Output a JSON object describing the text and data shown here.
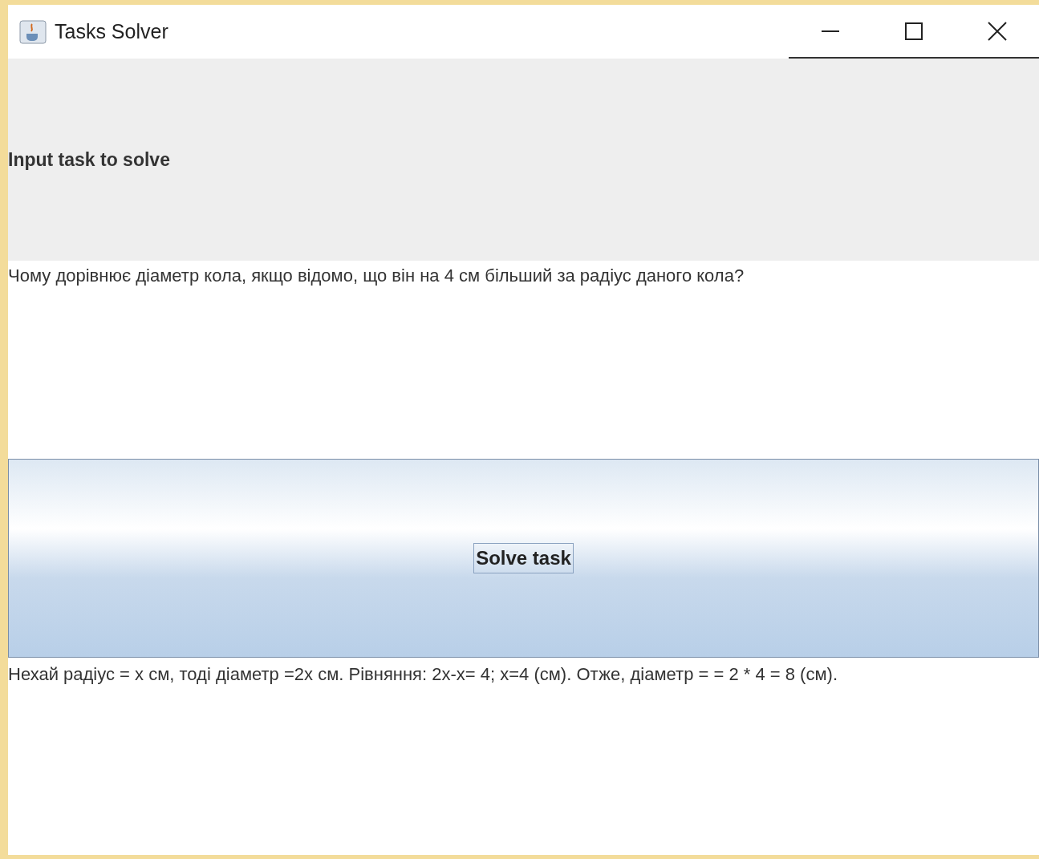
{
  "window": {
    "title": "Tasks Solver",
    "controls": [
      {
        "kind": "minimize"
      },
      {
        "kind": "maximize"
      },
      {
        "kind": "close"
      }
    ]
  },
  "prompt_label": "Input task to solve",
  "task_input": {
    "value": "Чому дорівнює діаметр кола, якщо відомо, що він на 4 см більший за радіус даного кола?"
  },
  "solve_button": {
    "label": "Solve task",
    "focused": true
  },
  "answer": "Нехай радіус = х см, тоді діаметр =2х см. Рівняння: 2х-х= 4; х=4 (см). Отже, діаметр = = 2 * 4 = 8 (см)."
}
